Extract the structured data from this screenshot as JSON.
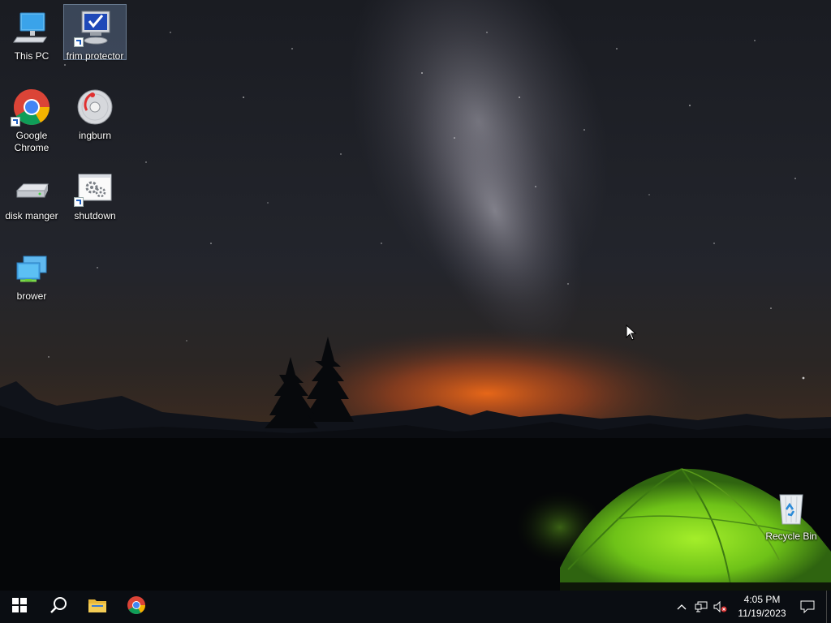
{
  "desktop": {
    "icons": [
      {
        "label": "This PC",
        "icon": "computer-icon"
      },
      {
        "label": "frim protector",
        "icon": "shield-monitor-icon"
      },
      {
        "label": "Google Chrome",
        "icon": "chrome-icon"
      },
      {
        "label": "ingburn",
        "icon": "disc-burn-icon"
      },
      {
        "label": "disk manger",
        "icon": "hard-drive-icon"
      },
      {
        "label": "shutdown",
        "icon": "settings-gears-icon"
      },
      {
        "label": "brower",
        "icon": "network-monitors-icon"
      },
      {
        "label": "Recycle Bin",
        "icon": "recycle-bin-icon"
      }
    ],
    "selected_icon": "frim protector"
  },
  "taskbar": {
    "pinned": [
      {
        "name": "Start",
        "icon": "windows-logo-icon"
      },
      {
        "name": "Search",
        "icon": "search-icon"
      },
      {
        "name": "File Explorer",
        "icon": "folder-icon"
      },
      {
        "name": "Google Chrome",
        "icon": "chrome-icon"
      }
    ],
    "tray": {
      "icons": [
        "chevron-up-icon",
        "network-icon",
        "volume-muted-icon"
      ],
      "time": "4:05 PM",
      "date": "11/19/2023",
      "notification_icon": "action-center-icon"
    }
  },
  "colors": {
    "taskbar_bg": "#0a0d12",
    "selection": "#7896be",
    "tent_green": "#7cd41e",
    "horizon_glow": "#e0601a"
  }
}
